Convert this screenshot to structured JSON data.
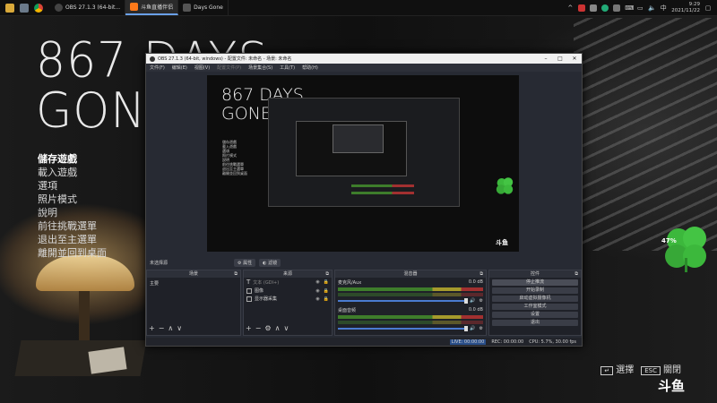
{
  "taskbar": {
    "apps": [
      {
        "label": "OBS 27.1.3 (64-bit...",
        "color": "#3a3a3a",
        "active": false
      },
      {
        "label": "斗鱼直播伴侣",
        "color": "#ff7a1a",
        "active": true
      },
      {
        "label": "Days Gone",
        "color": "#3a3a3a",
        "active": false
      }
    ],
    "time": "9:29",
    "date": "2021/11/22"
  },
  "game": {
    "title_line1": "867 DAYS",
    "title_line2": "GONE",
    "menu": [
      "儲存遊戲",
      "載入遊戲",
      "選項",
      "照片模式",
      "說明",
      "前往挑戰選單",
      "退出至主選單",
      "離開並回到桌面"
    ],
    "hint_select_key": "↵",
    "hint_select": "選擇",
    "hint_close_key": "ESC",
    "hint_close": "關閉",
    "brand": "斗鱼"
  },
  "widget": {
    "percent": "47%"
  },
  "obs": {
    "title": "OBS 27.1.3 (64-bit, windows) - 配置文件: 未命名 - 场景: 未命名",
    "menus": [
      "文件(F)",
      "编辑(E)",
      "视图(V)",
      "配置文件(P)",
      "场景集合(S)",
      "工具(T)",
      "帮助(H)"
    ],
    "no_source": "未选择源",
    "toolbar_props": "属性",
    "toolbar_filters": "滤镜",
    "scenes_header": "场景",
    "scenes": [
      "主要"
    ],
    "sources_header": "来源",
    "sources": [
      "文本 (GDI+)",
      "图像",
      "显示器采集"
    ],
    "mixer_header": "混音器",
    "mixer": [
      {
        "name": "麦克风/Aux",
        "db": "0.0 dB"
      },
      {
        "name": "桌面音频",
        "db": "0.0 dB"
      }
    ],
    "controls_header": "控件",
    "controls": [
      "停止推流",
      "开始录制",
      "启动虚拟摄像机",
      "工作室模式",
      "设置",
      "退出"
    ],
    "status": {
      "live": "LIVE: 00:00:00",
      "rec": "REC: 00:00:00",
      "cpu": "CPU: 5.7%, 30.00 fps"
    }
  }
}
